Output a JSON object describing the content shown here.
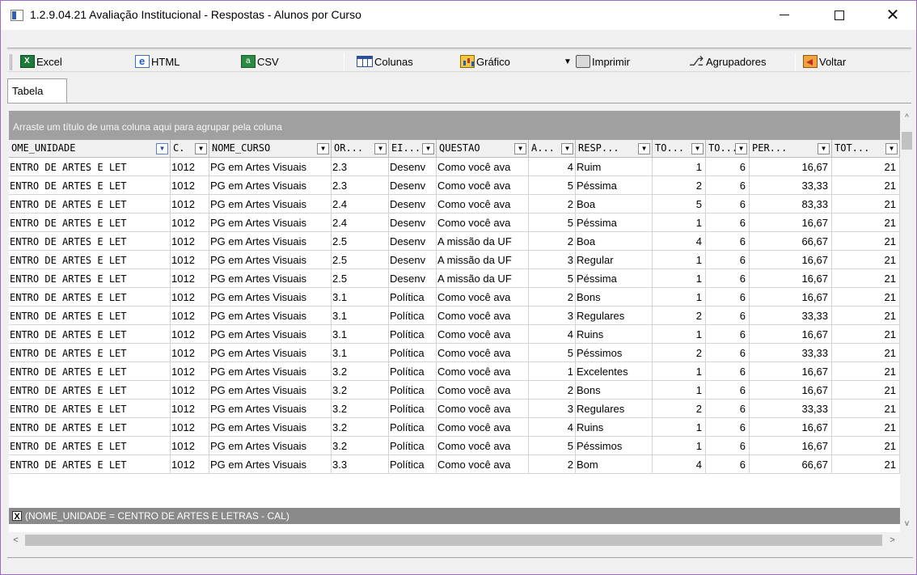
{
  "window": {
    "title": "1.2.9.04.21 Avaliação Institucional - Respostas - Alunos por Curso",
    "min_label": "",
    "close_label": "✕"
  },
  "toolbar": {
    "excel": "Excel",
    "html": "HTML",
    "csv": "CSV",
    "columns": "Colunas",
    "chart": "Gráfico",
    "print": "Imprimir",
    "print_arrow": "▼",
    "groupers": "Agrupadores",
    "back": "Voltar"
  },
  "tabs": [
    {
      "label": "Tabela"
    }
  ],
  "grid": {
    "group_panel_hint": "Arraste um título de uma coluna aqui para agrupar pela coluna",
    "dropdown_glyph": "▼",
    "headers": [
      "OME_UNIDADE",
      "C.",
      "NOME_CURSO",
      "OR...",
      "EI...",
      "QUESTAO",
      "A...",
      "RESP...",
      "TO...",
      "TO...",
      "PER...",
      "TOT..."
    ],
    "rows": [
      [
        "ENTRO DE ARTES E LET",
        "1012",
        "PG em Artes Visuais",
        "2.3",
        "Desenv",
        "Como você ava",
        "4",
        "Ruim",
        "1",
        "6",
        "16,67",
        "21"
      ],
      [
        "ENTRO DE ARTES E LET",
        "1012",
        "PG em Artes Visuais",
        "2.3",
        "Desenv",
        "Como você ava",
        "5",
        "Péssima",
        "2",
        "6",
        "33,33",
        "21"
      ],
      [
        "ENTRO DE ARTES E LET",
        "1012",
        "PG em Artes Visuais",
        "2.4",
        "Desenv",
        "Como você ava",
        "2",
        "Boa",
        "5",
        "6",
        "83,33",
        "21"
      ],
      [
        "ENTRO DE ARTES E LET",
        "1012",
        "PG em Artes Visuais",
        "2.4",
        "Desenv",
        "Como você ava",
        "5",
        "Péssima",
        "1",
        "6",
        "16,67",
        "21"
      ],
      [
        "ENTRO DE ARTES E LET",
        "1012",
        "PG em Artes Visuais",
        "2.5",
        "Desenv",
        "A missão da UF",
        "2",
        "Boa",
        "4",
        "6",
        "66,67",
        "21"
      ],
      [
        "ENTRO DE ARTES E LET",
        "1012",
        "PG em Artes Visuais",
        "2.5",
        "Desenv",
        "A missão da UF",
        "3",
        "Regular",
        "1",
        "6",
        "16,67",
        "21"
      ],
      [
        "ENTRO DE ARTES E LET",
        "1012",
        "PG em Artes Visuais",
        "2.5",
        "Desenv",
        "A missão da UF",
        "5",
        "Péssima",
        "1",
        "6",
        "16,67",
        "21"
      ],
      [
        "ENTRO DE ARTES E LET",
        "1012",
        "PG em Artes Visuais",
        "3.1",
        "Política",
        "Como você ava",
        "2",
        "Bons",
        "1",
        "6",
        "16,67",
        "21"
      ],
      [
        "ENTRO DE ARTES E LET",
        "1012",
        "PG em Artes Visuais",
        "3.1",
        "Política",
        "Como você ava",
        "3",
        "Regulares",
        "2",
        "6",
        "33,33",
        "21"
      ],
      [
        "ENTRO DE ARTES E LET",
        "1012",
        "PG em Artes Visuais",
        "3.1",
        "Política",
        "Como você ava",
        "4",
        "Ruins",
        "1",
        "6",
        "16,67",
        "21"
      ],
      [
        "ENTRO DE ARTES E LET",
        "1012",
        "PG em Artes Visuais",
        "3.1",
        "Política",
        "Como você ava",
        "5",
        "Péssimos",
        "2",
        "6",
        "33,33",
        "21"
      ],
      [
        "ENTRO DE ARTES E LET",
        "1012",
        "PG em Artes Visuais",
        "3.2",
        "Política",
        "Como você ava",
        "1",
        "Excelentes",
        "1",
        "6",
        "16,67",
        "21"
      ],
      [
        "ENTRO DE ARTES E LET",
        "1012",
        "PG em Artes Visuais",
        "3.2",
        "Política",
        "Como você ava",
        "2",
        "Bons",
        "1",
        "6",
        "16,67",
        "21"
      ],
      [
        "ENTRO DE ARTES E LET",
        "1012",
        "PG em Artes Visuais",
        "3.2",
        "Política",
        "Como você ava",
        "3",
        "Regulares",
        "2",
        "6",
        "33,33",
        "21"
      ],
      [
        "ENTRO DE ARTES E LET",
        "1012",
        "PG em Artes Visuais",
        "3.2",
        "Política",
        "Como você ava",
        "4",
        "Ruins",
        "1",
        "6",
        "16,67",
        "21"
      ],
      [
        "ENTRO DE ARTES E LET",
        "1012",
        "PG em Artes Visuais",
        "3.2",
        "Política",
        "Como você ava",
        "5",
        "Péssimos",
        "1",
        "6",
        "16,67",
        "21"
      ],
      [
        "ENTRO DE ARTES E LET",
        "1012",
        "PG em Artes Visuais",
        "3.3",
        "Política",
        "Como você ava",
        "2",
        "Bom",
        "4",
        "6",
        "66,67",
        "21"
      ]
    ],
    "filter_text": "(NOME_UNIDADE = CENTRO DE ARTES E LETRAS - CAL)",
    "filter_close": "X"
  },
  "scroll": {
    "up": "^",
    "down": "v",
    "left": "<",
    "right": ">"
  }
}
